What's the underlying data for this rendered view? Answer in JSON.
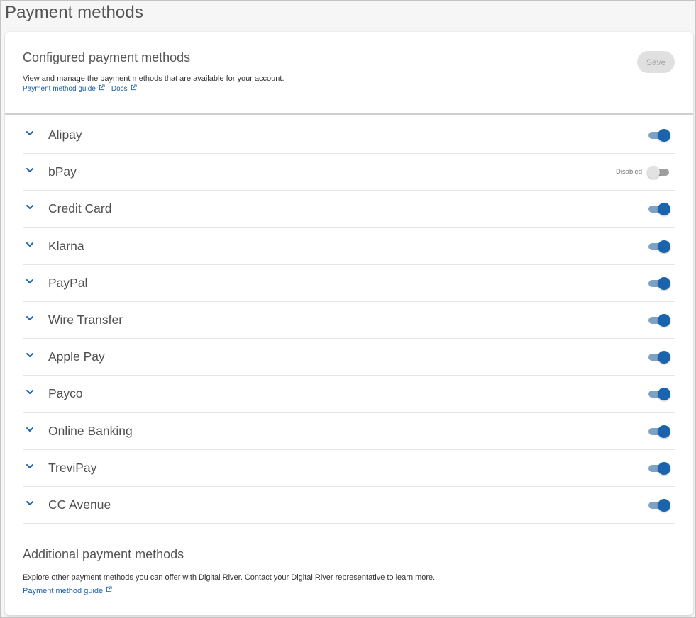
{
  "page": {
    "title": "Payment methods"
  },
  "configured": {
    "title": "Configured payment methods",
    "description": "View and manage the payment methods that are available for your account.",
    "links": [
      {
        "label": "Payment method guide",
        "icon": "external-link-icon"
      },
      {
        "label": "Docs",
        "icon": "external-link-icon"
      }
    ],
    "save_label": "Save"
  },
  "methods": [
    {
      "name": "Alipay",
      "enabled": true
    },
    {
      "name": "bPay",
      "enabled": false,
      "status_text": "Disabled"
    },
    {
      "name": "Credit Card",
      "enabled": true
    },
    {
      "name": "Klarna",
      "enabled": true
    },
    {
      "name": "PayPal",
      "enabled": true
    },
    {
      "name": "Wire Transfer",
      "enabled": true
    },
    {
      "name": "Apple Pay",
      "enabled": true
    },
    {
      "name": "Payco",
      "enabled": true
    },
    {
      "name": "Online Banking",
      "enabled": true
    },
    {
      "name": "TreviPay",
      "enabled": true
    },
    {
      "name": "CC Avenue",
      "enabled": true
    }
  ],
  "additional": {
    "title": "Additional payment methods",
    "description": "Explore other payment methods you can offer with Digital River. Contact your Digital River representative to learn more.",
    "link_label": "Payment method guide"
  },
  "colors": {
    "accent": "#1a64ae",
    "link": "#1a5fa8",
    "toggle_track_on": "#7ea1c6",
    "toggle_track_off": "#9e9e9e",
    "save_disabled_bg": "#e0e0e0"
  },
  "icons": {
    "expand": "chevron-down-icon",
    "external": "external-link-icon"
  }
}
